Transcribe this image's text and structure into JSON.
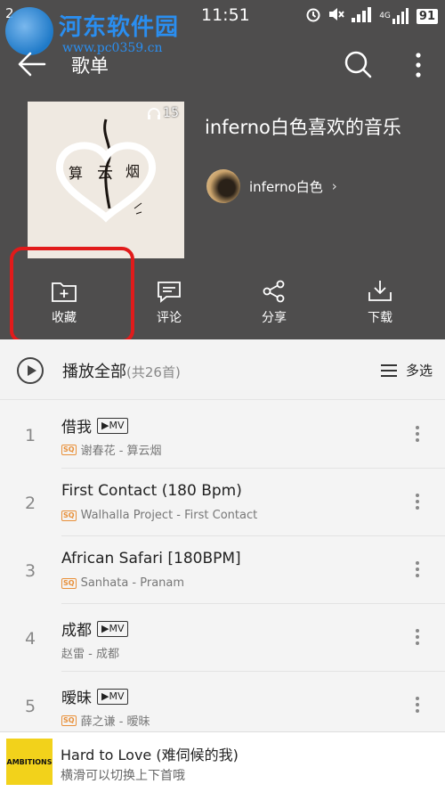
{
  "status_bar": {
    "left_indicator": "2",
    "time": "11:51",
    "network": "4G",
    "battery": "91"
  },
  "watermark": {
    "title": "河东软件园",
    "url": "www.pc0359.cn"
  },
  "app_bar": {
    "title": "歌单"
  },
  "playlist": {
    "title": "inferno白色喜欢的音乐",
    "listen_count": "15",
    "author": "inferno白色"
  },
  "actions": [
    {
      "label": "收藏",
      "icon": "folder-add-icon"
    },
    {
      "label": "评论",
      "icon": "comment-icon"
    },
    {
      "label": "分享",
      "icon": "share-icon"
    },
    {
      "label": "下载",
      "icon": "download-icon"
    }
  ],
  "play_all": {
    "label": "播放全部",
    "count": "(共26首)",
    "multi_select": "多选"
  },
  "songs": [
    {
      "num": "1",
      "title": "借我",
      "mv": "▶MV",
      "sq": "SQ",
      "sub": "谢春花 - 算云烟"
    },
    {
      "num": "2",
      "title": "First Contact (180 Bpm)",
      "mv": "",
      "sq": "SQ",
      "sub": "Walhalla Project - First Contact"
    },
    {
      "num": "3",
      "title": "African Safari [180BPM]",
      "mv": "",
      "sq": "SQ",
      "sub": "Sanhata - Pranam"
    },
    {
      "num": "4",
      "title": "成都",
      "mv": "▶MV",
      "sq": "",
      "sub": "赵雷 - 成都"
    },
    {
      "num": "5",
      "title": "暧昧",
      "mv": "▶MV",
      "sq": "SQ",
      "sub": "薛之谦 - 暧昧"
    }
  ],
  "player": {
    "art_text": "AMBITIONS",
    "title": "Hard to Love (难伺候的我)",
    "subtitle": "横滑可以切换上下首哦"
  },
  "colors": {
    "header_bg": "#4e4d4d",
    "highlight": "#e11b1b",
    "sq_badge": "#e8903a",
    "watermark": "#2a8ef0"
  }
}
